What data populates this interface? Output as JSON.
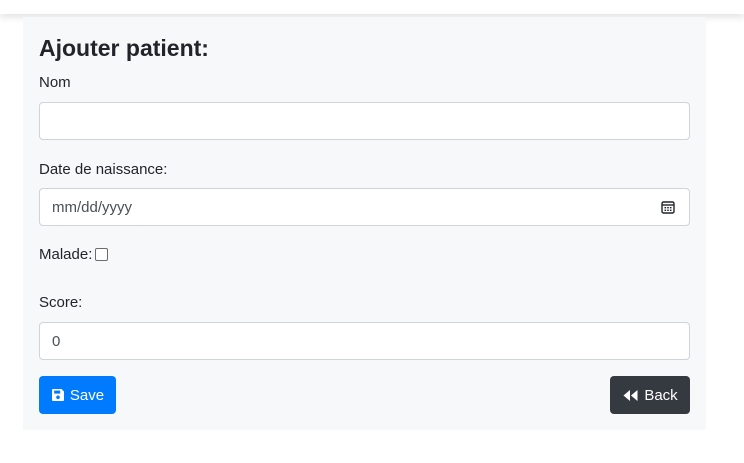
{
  "form": {
    "title": "Ajouter patient:",
    "nom": {
      "label": "Nom",
      "value": ""
    },
    "date": {
      "label": "Date de naissance:",
      "placeholder": "mm/dd/yyyy"
    },
    "malade": {
      "label": "Malade:",
      "checked": false
    },
    "score": {
      "label": "Score:",
      "value": "0"
    }
  },
  "buttons": {
    "save_label": "Save",
    "back_label": "Back"
  },
  "icons": {
    "save": "floppy-disk-icon",
    "back": "rewind-icon",
    "calendar": "calendar-icon"
  },
  "colors": {
    "primary": "#007bff",
    "dark": "#343a40",
    "panel": "#f7f8fa"
  }
}
